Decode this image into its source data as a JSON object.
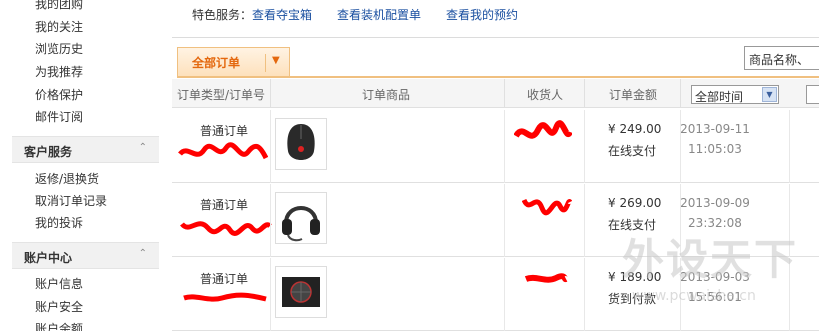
{
  "sidebar": {
    "top_links": [
      "我的团购",
      "我的关注",
      "浏览历史",
      "为我推荐",
      "价格保护",
      "邮件订阅"
    ],
    "sections": [
      {
        "title": "客户服务",
        "items": [
          "返修/退换货",
          "取消订单记录",
          "我的投诉"
        ]
      },
      {
        "title": "账户中心",
        "items": [
          "账户信息",
          "账户安全",
          "账户余额"
        ]
      }
    ]
  },
  "feature_bar": {
    "label": "特色服务：",
    "links": [
      "查看夺宝箱",
      "查看装机配置单",
      "查看我的预约"
    ]
  },
  "tabs": {
    "all_orders": "全部订单"
  },
  "search": {
    "placeholder": "商品名称、"
  },
  "table": {
    "headers": {
      "type": "订单类型/订单号",
      "goods": "订单商品",
      "receiver": "收货人",
      "amount": "订单金额"
    },
    "time_filter": "全部时间",
    "rows": [
      {
        "type": "普通订单",
        "product_icon": "gaming-mouse-icon",
        "amount": "¥ 249.00",
        "payment": "在线支付",
        "date": "2013-09-11",
        "time": "11:05:03"
      },
      {
        "type": "普通订单",
        "product_icon": "headset-icon",
        "amount": "¥ 269.00",
        "payment": "在线支付",
        "date": "2013-09-09",
        "time": "23:32:08"
      },
      {
        "type": "普通订单",
        "product_icon": "power-supply-icon",
        "amount": "¥ 189.00",
        "payment": "货到付款",
        "date": "2013-09-03",
        "time": "15:56:01"
      }
    ]
  },
  "watermark": {
    "text": "外设天下",
    "url": "www.pcwaishe.cn"
  },
  "colors": {
    "accent_orange": "#e4680e",
    "link_blue": "#1a4fa0",
    "redaction_red": "#ff0000"
  }
}
